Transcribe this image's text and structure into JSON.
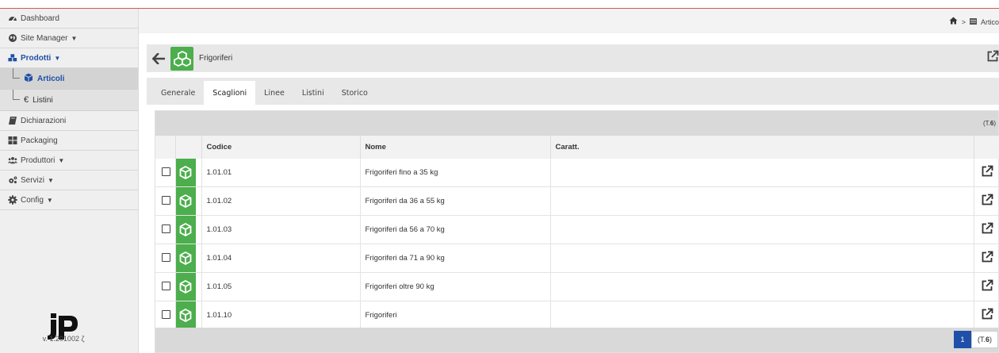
{
  "sidebar": {
    "items": [
      {
        "label": "Dashboard",
        "icon": "dashboard-icon"
      },
      {
        "label": "Site Manager",
        "icon": "globe-icon",
        "caret": "▼"
      },
      {
        "label": "Prodotti",
        "icon": "cubes-icon",
        "caret": "▼"
      },
      {
        "label": "Dichiarazioni",
        "icon": "book-icon"
      },
      {
        "label": "Packaging",
        "icon": "grid-icon"
      },
      {
        "label": "Produttori",
        "icon": "users-icon",
        "caret": "▼"
      },
      {
        "label": "Servizi",
        "icon": "gears-icon",
        "caret": "▼"
      },
      {
        "label": "Config",
        "icon": "cog-icon",
        "caret": "▼"
      }
    ],
    "subitems": [
      {
        "label": "Articoli",
        "icon": "cube-icon"
      },
      {
        "label": "Listini",
        "icon": "euro-icon",
        "glyph": "€"
      }
    ],
    "logo": "jP",
    "version": "v. 1.201002 ζ"
  },
  "breadcrumb": {
    "separator": ">",
    "current": "Artico"
  },
  "titlebar": {
    "back_glyph": "🡐",
    "title": "Frigoriferi"
  },
  "tabs": [
    {
      "label": "Generale",
      "active": false
    },
    {
      "label": "Scaglioni",
      "active": true
    },
    {
      "label": "Linee",
      "active": false
    },
    {
      "label": "Listini",
      "active": false
    },
    {
      "label": "Storico",
      "active": false
    }
  ],
  "table": {
    "count_prefix": "(T.",
    "count": "6",
    "count_suffix": ")",
    "columns": [
      "",
      "",
      "Codice",
      "Nome",
      "Caratt.",
      ""
    ],
    "rows": [
      {
        "codice": "1.01.01",
        "nome": "Frigoriferi fino a 35 kg",
        "caratt": ""
      },
      {
        "codice": "1.01.02",
        "nome": "Frigoriferi da 36 a 55 kg",
        "caratt": ""
      },
      {
        "codice": "1.01.03",
        "nome": "Frigoriferi da 56 a 70 kg",
        "caratt": ""
      },
      {
        "codice": "1.01.04",
        "nome": "Frigoriferi da 71 a 90 kg",
        "caratt": ""
      },
      {
        "codice": "1.01.05",
        "nome": "Frigoriferi oltre 90 kg",
        "caratt": ""
      },
      {
        "codice": "1.01.10",
        "nome": "Frigoriferi",
        "caratt": ""
      }
    ]
  },
  "pager": {
    "current": "1",
    "total_prefix": "(T.",
    "total": "6",
    "total_suffix": ")"
  },
  "colors": {
    "accent_blue": "#1f4fa8",
    "green": "#4cae4c",
    "top_border": "#d9534f"
  }
}
